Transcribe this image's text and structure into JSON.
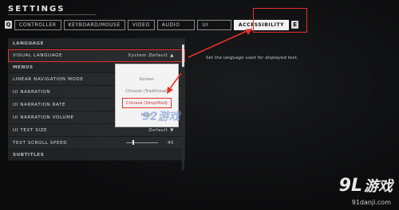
{
  "page_title": "SETTINGS",
  "tabs": {
    "prev_key": "Q",
    "items": [
      {
        "label": "CONTROLLER"
      },
      {
        "label": "KEYBOARD/MOUSE"
      },
      {
        "label": "VIDEO"
      },
      {
        "label": "AUDIO"
      },
      {
        "label": "UI"
      },
      {
        "label": "ACCESSIBILITY",
        "active": true
      }
    ],
    "next_key": "E"
  },
  "settings": {
    "section_language": "LANGUAGE",
    "visual_language": {
      "label": "VISUAL LANGUAGE",
      "value": "System Default",
      "caret": "▲"
    },
    "section_menus": "MENUS",
    "linear_navigation": {
      "label": "LINEAR NAVIGATION MODE"
    },
    "ui_narration": {
      "label": "UI NARRATION"
    },
    "ui_narration_rate": {
      "label": "UI NARRATION RATE"
    },
    "ui_narration_volume": {
      "label": "UI NARRATION VOLUME"
    },
    "ui_text_size": {
      "label": "UI TEXT SIZE",
      "value": "Default",
      "caret": "▼"
    },
    "text_scroll_speed": {
      "label": "TEXT SCROLL SPEED",
      "value": "45",
      "level_fraction": 0.2
    },
    "section_subtitles": "SUBTITLES"
  },
  "help_text": "Set the language used for displayed text.",
  "language_dropdown": {
    "options": [
      {
        "label": "Korean"
      },
      {
        "label": "Chinese (Traditional)"
      },
      {
        "label": "Chinese (Simplified)",
        "highlighted": true
      },
      {
        "label": "Polish"
      }
    ]
  },
  "watermark": {
    "mid_text": "92游戏",
    "logo_num": "9L",
    "logo_cn": "游戏",
    "url": "91danji.com"
  },
  "colors": {
    "accent_red": "#e53228",
    "active_tab_bg": "#f2f2f2"
  }
}
